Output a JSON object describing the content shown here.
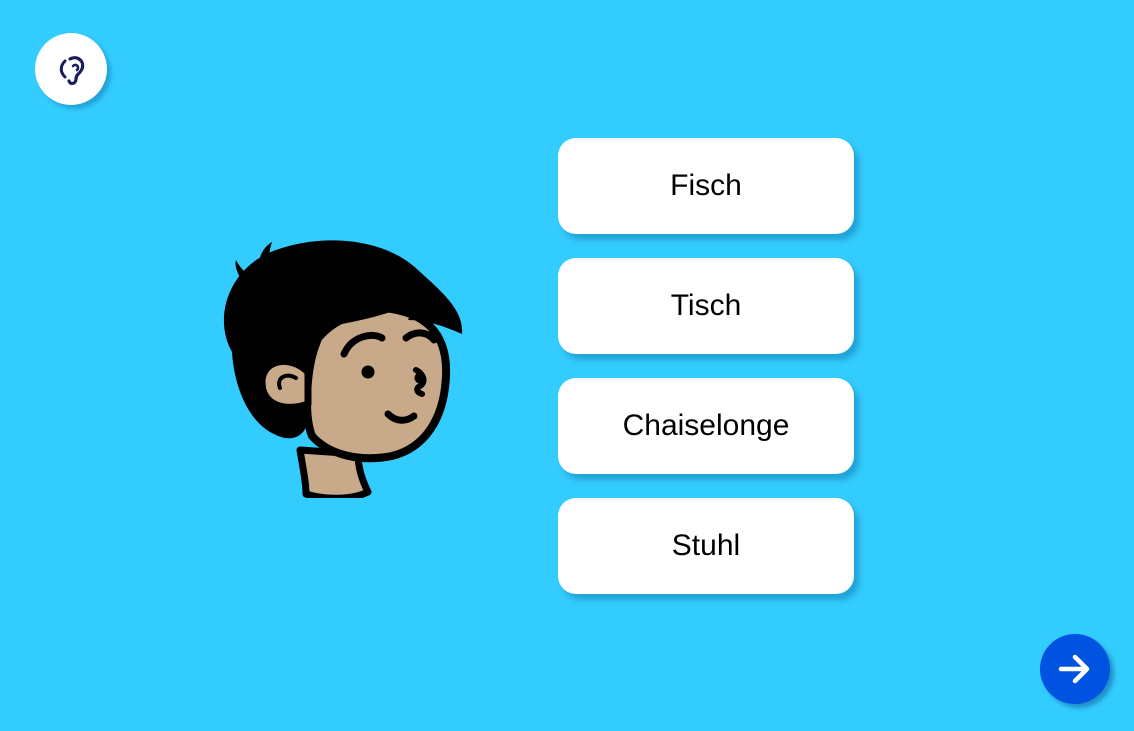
{
  "header": {
    "audio_icon": "ear-icon"
  },
  "illustration": {
    "subject": "boy-face"
  },
  "options": [
    {
      "label": "Fisch"
    },
    {
      "label": "Tisch"
    },
    {
      "label": "Chaiselonge"
    },
    {
      "label": "Stuhl"
    }
  ],
  "footer": {
    "next_icon": "arrow-right-icon"
  },
  "colors": {
    "background": "#33ccff",
    "option_background": "#ffffff",
    "next_button": "#0052e0",
    "icon_dark": "#1a1a5e",
    "skin": "#c8a98a"
  }
}
